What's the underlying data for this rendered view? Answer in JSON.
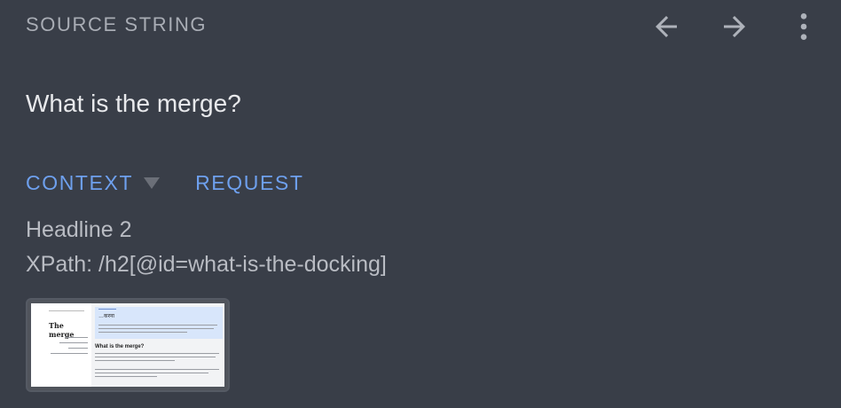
{
  "header": {
    "label": "SOURCE STRING",
    "prev_icon": "arrow-left-icon",
    "next_icon": "arrow-right-icon",
    "menu_icon": "more-vert-icon"
  },
  "source": {
    "text": "What is the merge?"
  },
  "tabs": {
    "context_label": "CONTEXT",
    "request_label": "REQUEST",
    "active": "context"
  },
  "context": {
    "element_type": "Headline 2",
    "xpath": "XPath: /h2[@id=what-is-the-docking]"
  },
  "screenshot_thumbnail": {
    "sidebar_title": "The merge",
    "banner_title": "…करना",
    "section_title": "What is the merge?"
  },
  "colors": {
    "background": "#393e48",
    "accent": "#6ea0ee",
    "text_primary": "#e8e9ec",
    "text_secondary": "#b9bcc3",
    "icon": "#aeb2ba"
  }
}
